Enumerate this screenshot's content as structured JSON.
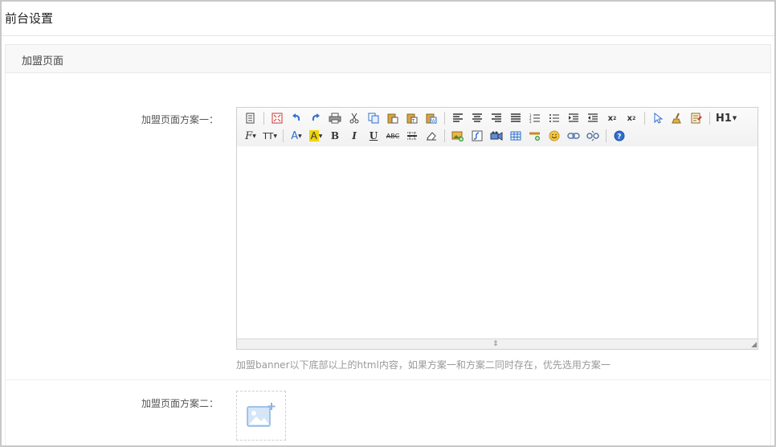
{
  "page": {
    "title": "前台设置"
  },
  "section": {
    "title": "加盟页面"
  },
  "form": {
    "field1_label": "加盟页面方案一：",
    "field1_hint": "加盟banner以下底部以上的html内容，如果方案一和方案二同时存在，优先选用方案一",
    "field2_label": "加盟页面方案二："
  },
  "toolbar": {
    "row1": [
      "source",
      "fullscreen",
      "undo",
      "redo",
      "print",
      "cut",
      "copy",
      "paste",
      "paste-text",
      "paste-word",
      "paste-html",
      "align-left",
      "align-center",
      "align-right",
      "justify",
      "ordered-list",
      "unordered-list",
      "indent",
      "outdent",
      "subscript",
      "superscript",
      "select-all",
      "clear-format",
      "quick-format",
      "heading"
    ],
    "heading_label": "H1",
    "font_label": "F",
    "font_size_label": "TT",
    "bold_label": "B",
    "italic_label": "I",
    "underline_label": "U",
    "strike_label": "ABC",
    "font_color_label": "A",
    "highlight_label": "A"
  },
  "colors": {
    "border": "#c8c8c8",
    "toolbar_bg": "#f1f1f1",
    "hint_text": "#999999",
    "accent_blue": "#2f6fcf"
  }
}
